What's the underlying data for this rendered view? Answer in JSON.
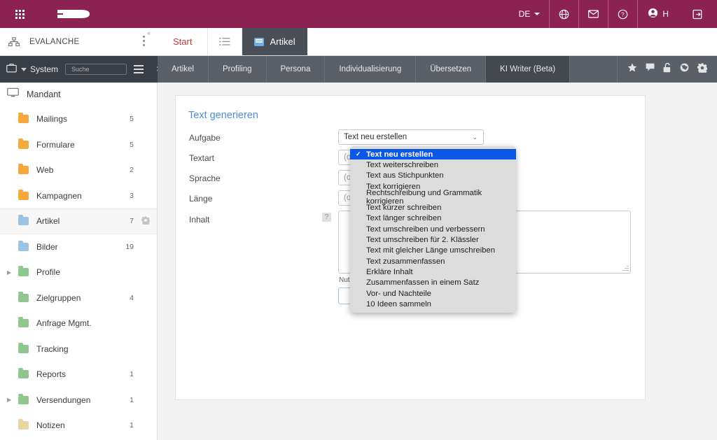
{
  "theme": {
    "brand_color": "#8b2252",
    "accent_blue": "#4a90d9",
    "select_highlight": "#0a57e8",
    "toolbar_dark": "#3a3f47",
    "module_bar": "#5a5f68"
  },
  "topbar": {
    "apps_icon": "grid-apps-icon",
    "logo": "evalanche-logo",
    "language": "DE",
    "icons": [
      "globe-icon",
      "mail-icon",
      "help-icon"
    ],
    "user_initial": "H",
    "logout_icon": "logout-icon"
  },
  "instance": {
    "name": "EVALANCHE",
    "icon": "sitemap-icon",
    "kebab": "more-options-icon",
    "collapse": "«"
  },
  "tabs": [
    {
      "label": "Start",
      "active": false
    },
    {
      "label": "",
      "icon": "list-icon",
      "active": false
    },
    {
      "label": "Artikel",
      "active": true
    }
  ],
  "left_toolbar": {
    "briefcase_icon": "briefcase-icon",
    "scope_label": "System",
    "search_placeholder": "Suche",
    "search_value": "",
    "clear_label": "✕",
    "menu_icon": "hamburger-icon"
  },
  "module_tabs": [
    {
      "label": "Artikel",
      "active": false
    },
    {
      "label": "Profiling",
      "active": false
    },
    {
      "label": "Persona",
      "active": false
    },
    {
      "label": "Individualisierung",
      "active": false
    },
    {
      "label": "Übersetzen",
      "active": false
    },
    {
      "label": "KI Writer (Beta)",
      "active": true
    }
  ],
  "module_icons": [
    "star-icon",
    "comment-icon",
    "unlock-icon",
    "globe-icon",
    "gear-icon"
  ],
  "sidebar": {
    "root_label": "Mandant",
    "root_icon": "monitor-icon",
    "items": [
      {
        "label": "Mailings",
        "count": "5",
        "color": "#f5a83c",
        "expandable": false,
        "selected": false
      },
      {
        "label": "Formulare",
        "count": "5",
        "color": "#f5a83c",
        "expandable": false,
        "selected": false
      },
      {
        "label": "Web",
        "count": "2",
        "color": "#f5a83c",
        "expandable": false,
        "selected": false
      },
      {
        "label": "Kampagnen",
        "count": "3",
        "color": "#f5a83c",
        "expandable": false,
        "selected": false
      },
      {
        "label": "Artikel",
        "count": "7",
        "color": "#9dc3e0",
        "expandable": false,
        "selected": true
      },
      {
        "label": "Bilder",
        "count": "19",
        "color": "#9dc3e0",
        "expandable": false,
        "selected": false
      },
      {
        "label": "Profile",
        "count": "",
        "color": "#8fc78f",
        "expandable": true,
        "selected": false
      },
      {
        "label": "Zielgruppen",
        "count": "4",
        "color": "#8fc78f",
        "expandable": false,
        "selected": false
      },
      {
        "label": "Anfrage Mgmt.",
        "count": "",
        "color": "#8fc78f",
        "expandable": false,
        "selected": false
      },
      {
        "label": "Tracking",
        "count": "",
        "color": "#8fc78f",
        "expandable": false,
        "selected": false
      },
      {
        "label": "Reports",
        "count": "1",
        "color": "#8fc78f",
        "expandable": false,
        "selected": false
      },
      {
        "label": "Versendungen",
        "count": "1",
        "color": "#8fc78f",
        "expandable": true,
        "selected": false
      },
      {
        "label": "Notizen",
        "count": "1",
        "color": "#e8d6a0",
        "expandable": false,
        "selected": false
      }
    ]
  },
  "form": {
    "title": "Text generieren",
    "labels": {
      "aufgabe": "Aufgabe",
      "textart": "Textart",
      "sprache": "Sprache",
      "laenge": "Länge",
      "inhalt": "Inhalt"
    },
    "help_icon_label": "?",
    "aufgabe_value": "Text neu erstellen",
    "textart_placeholder": "(optional)",
    "sprache_placeholder": "(optional)",
    "laenge_placeholder": "(optional)",
    "inhalt_value": "",
    "note": "Nutzung von OpenAI",
    "chevron": "⌄"
  },
  "dropdown": {
    "checkmark": "✓",
    "selected_index": 0,
    "options": [
      "Text neu erstellen",
      "Text weiterschreiben",
      "Text aus Stichpunkten",
      "Text korrigieren",
      "Rechtschreibung und Grammatik korrigieren",
      "Text kürzer schreiben",
      "Text länger schreiben",
      "Text umschreiben und verbessern",
      "Text umschreiben für 2. Klässler",
      "Text mit gleicher Länge umschreiben",
      "Text zusammenfassen",
      "Erkläre Inhalt",
      "Zusammenfassen in einem Satz",
      "Vor- und Nachteile",
      "10 Ideen sammeln"
    ]
  }
}
